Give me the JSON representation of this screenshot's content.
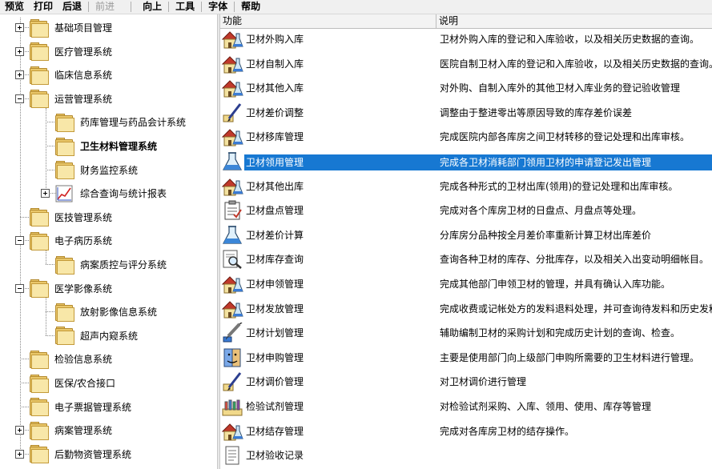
{
  "menubar": {
    "items": [
      {
        "label": "预览",
        "enabled": true
      },
      {
        "label": "打印",
        "enabled": true
      },
      {
        "label": "后退",
        "enabled": true
      },
      {
        "label": "前进",
        "enabled": false
      },
      {
        "label": "向上",
        "enabled": true
      },
      {
        "label": "工具",
        "enabled": true
      },
      {
        "label": "字体",
        "enabled": true
      },
      {
        "label": "帮助",
        "enabled": true
      }
    ]
  },
  "tree": {
    "nodes": [
      {
        "label": "基础项目管理",
        "level": 0,
        "expander": "plus",
        "icon": "folder-icon"
      },
      {
        "label": "医疗管理系统",
        "level": 0,
        "expander": "plus",
        "icon": "folder-icon"
      },
      {
        "label": "临床信息系统",
        "level": 0,
        "expander": "plus",
        "icon": "folder-icon"
      },
      {
        "label": "运营管理系统",
        "level": 0,
        "expander": "minus",
        "icon": "folder-icon"
      },
      {
        "label": "药库管理与药品会计系统",
        "level": 1,
        "expander": "none",
        "icon": "folder-icon"
      },
      {
        "label": "卫生材料管理系统",
        "level": 1,
        "expander": "none",
        "icon": "folder-icon",
        "selected": true
      },
      {
        "label": "财务监控系统",
        "level": 1,
        "expander": "none",
        "icon": "folder-icon"
      },
      {
        "label": "综合查询与统计报表",
        "level": 1,
        "expander": "plus",
        "icon": "chart-icon"
      },
      {
        "label": "医技管理系统",
        "level": 0,
        "expander": "none",
        "icon": "folder-icon"
      },
      {
        "label": "电子病历系统",
        "level": 0,
        "expander": "minus",
        "icon": "folder-icon"
      },
      {
        "label": "病案质控与评分系统",
        "level": 1,
        "expander": "none",
        "icon": "folder-icon"
      },
      {
        "label": "医学影像系统",
        "level": 0,
        "expander": "minus",
        "icon": "folder-icon"
      },
      {
        "label": "放射影像信息系统",
        "level": 1,
        "expander": "none",
        "icon": "folder-icon"
      },
      {
        "label": "超声内窥系统",
        "level": 1,
        "expander": "none",
        "icon": "folder-icon"
      },
      {
        "label": "检验信息系统",
        "level": 0,
        "expander": "none",
        "icon": "folder-icon"
      },
      {
        "label": "医保/农合接口",
        "level": 0,
        "expander": "none",
        "icon": "folder-icon"
      },
      {
        "label": "电子票据管理系统",
        "level": 0,
        "expander": "none",
        "icon": "folder-icon"
      },
      {
        "label": "病案管理系统",
        "level": 0,
        "expander": "plus",
        "icon": "folder-icon"
      },
      {
        "label": "后勤物资管理系统",
        "level": 0,
        "expander": "plus",
        "icon": "folder-icon"
      }
    ]
  },
  "list": {
    "columns": [
      "功能",
      "说明"
    ],
    "rows": [
      {
        "name": "卫材外购入库",
        "desc": "卫材外购入库的登记和入库验收，以及相关历史数据的查询。",
        "icon": "house-flask-icon"
      },
      {
        "name": "卫材自制入库",
        "desc": "医院自制卫材入库的登记和入库验收，以及相关历史数据的查询。",
        "icon": "house-flask-icon"
      },
      {
        "name": "卫材其他入库",
        "desc": "对外购、自制入库外的其他卫材入库业务的登记验收管理",
        "icon": "house-flask-icon"
      },
      {
        "name": "卫材差价调整",
        "desc": "调整由于整进零出等原因导致的库存差价误差",
        "icon": "pen-icon"
      },
      {
        "name": "卫材移库管理",
        "desc": "完成医院内部各库房之间卫材转移的登记处理和出库审核。",
        "icon": "house-flask-icon"
      },
      {
        "name": "卫材领用管理",
        "desc": "完成各卫材消耗部门领用卫材的申请登记发出管理",
        "icon": "flask-icon",
        "selected": true
      },
      {
        "name": "卫材其他出库",
        "desc": "完成各种形式的卫材出库(领用)的登记处理和出库审核。",
        "icon": "house-flask-icon"
      },
      {
        "name": "卫材盘点管理",
        "desc": "完成对各个库房卫材的日盘点、月盘点等处理。",
        "icon": "clipboard-icon"
      },
      {
        "name": "卫材差价计算",
        "desc": "分库房分品种按全月差价率重新计算卫材出库差价",
        "icon": "flask-icon"
      },
      {
        "name": "卫材库存查询",
        "desc": "查询各种卫材的库存、分批库存，以及相关入出变动明细帐目。",
        "icon": "magnifier-doc-icon"
      },
      {
        "name": "卫材申领管理",
        "desc": "完成其他部门申领卫材的管理，并具有确认入库功能。",
        "icon": "house-flask-icon"
      },
      {
        "name": "卫材发放管理",
        "desc": "完成收费或记帐处方的发料退料处理，并可查询待发料和历史发料数据",
        "icon": "house-flask-icon"
      },
      {
        "name": "卫材计划管理",
        "desc": "辅助编制卫材的采购计划和完成历史计划的查询、检查。",
        "icon": "syringe-icon"
      },
      {
        "name": "卫材申购管理",
        "desc": "主要是使用部门向上级部门申购所需要的卫生材料进行管理。",
        "icon": "finder-icon"
      },
      {
        "name": "卫材调价管理",
        "desc": "对卫材调价进行管理",
        "icon": "pen-icon"
      },
      {
        "name": "检验试剂管理",
        "desc": "对检验试剂采购、入库、领用、使用、库存等管理",
        "icon": "reagent-icon"
      },
      {
        "name": "卫材结存管理",
        "desc": "完成对各库房卫材的结存操作。",
        "icon": "house-flask-icon"
      },
      {
        "name": "卫材验收记录",
        "desc": "",
        "icon": "doc-icon"
      }
    ]
  }
}
